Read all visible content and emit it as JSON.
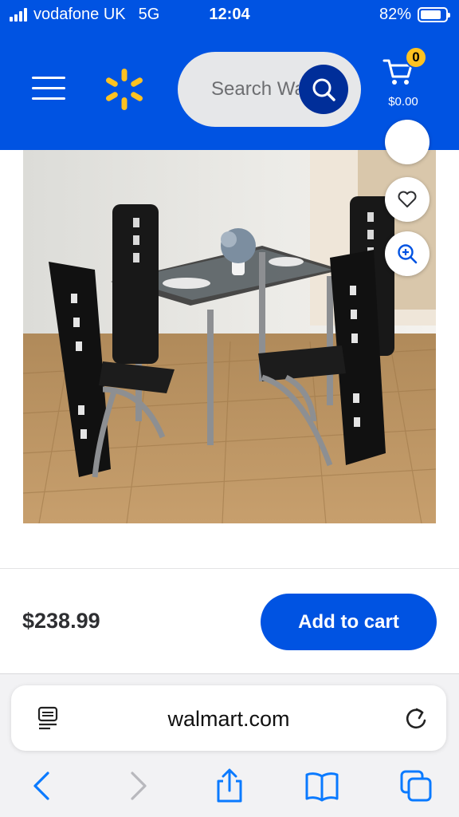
{
  "status_bar": {
    "carrier": "vodafone UK",
    "network": "5G",
    "time": "12:04",
    "battery": "82%",
    "battery_level": 0.82
  },
  "header": {
    "menu_icon": "hamburger-menu-icon",
    "logo_icon": "walmart-spark-logo",
    "search_placeholder": "Search Walmart",
    "search_icon": "search-icon",
    "cart": {
      "icon": "cart-icon",
      "count": "0",
      "total": "$0.00"
    }
  },
  "product": {
    "image_description_icon": "dining-set-photo",
    "actions": [
      {
        "name": "favorite-heart-icon"
      },
      {
        "name": "zoom-in-icon"
      }
    ]
  },
  "purchase_bar": {
    "price": "$238.99",
    "add_to_cart_label": "Add to cart"
  },
  "browser": {
    "url": "walmart.com",
    "reader_icon": "reader-mode-icon",
    "reload_icon": "reload-icon",
    "toolbar": [
      "back-icon",
      "forward-icon",
      "share-icon",
      "bookmarks-icon",
      "tabs-icon"
    ]
  },
  "colors": {
    "brand_blue": "#0053e2",
    "search_button": "#002e99",
    "spark_yellow": "#ffc220",
    "text_dark": "#2e2f32"
  }
}
